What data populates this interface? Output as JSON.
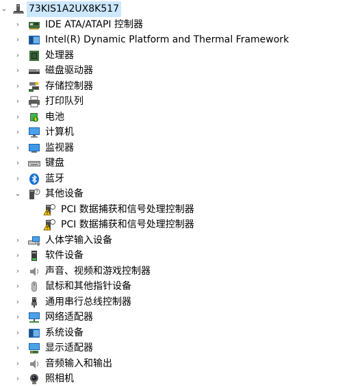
{
  "root": {
    "label": "73KIS1A2UX8K517",
    "expanded": true,
    "selected": true,
    "icon": "computer-icon"
  },
  "categories": [
    {
      "label": "IDE ATA/ATAPI 控制器",
      "icon": "ide-controller-icon",
      "expanded": false
    },
    {
      "label": "Intel(R) Dynamic Platform and Thermal Framework",
      "icon": "platform-device-icon",
      "expanded": false
    },
    {
      "label": "处理器",
      "icon": "processor-icon",
      "expanded": false
    },
    {
      "label": "磁盘驱动器",
      "icon": "disk-drive-icon",
      "expanded": false
    },
    {
      "label": "存储控制器",
      "icon": "storage-controller-icon",
      "expanded": false
    },
    {
      "label": "打印队列",
      "icon": "printer-icon",
      "expanded": false
    },
    {
      "label": "电池",
      "icon": "battery-icon",
      "expanded": false
    },
    {
      "label": "计算机",
      "icon": "computer-monitor-icon",
      "expanded": false
    },
    {
      "label": "监视器",
      "icon": "monitor-icon",
      "expanded": false
    },
    {
      "label": "键盘",
      "icon": "keyboard-icon",
      "expanded": false
    },
    {
      "label": "蓝牙",
      "icon": "bluetooth-icon",
      "expanded": false
    },
    {
      "label": "其他设备",
      "icon": "unknown-device-icon",
      "expanded": true,
      "children": [
        {
          "label": "PCI 数据捕获和信号处理控制器",
          "icon": "warning-device-icon"
        },
        {
          "label": "PCI 数据捕获和信号处理控制器",
          "icon": "warning-device-icon"
        }
      ]
    },
    {
      "label": "人体学输入设备",
      "icon": "hid-icon",
      "expanded": false
    },
    {
      "label": "软件设备",
      "icon": "software-device-icon",
      "expanded": false
    },
    {
      "label": "声音、视频和游戏控制器",
      "icon": "speaker-icon",
      "expanded": false
    },
    {
      "label": "鼠标和其他指针设备",
      "icon": "mouse-icon",
      "expanded": false
    },
    {
      "label": "通用串行总线控制器",
      "icon": "usb-icon",
      "expanded": false
    },
    {
      "label": "网络适配器",
      "icon": "network-adapter-icon",
      "expanded": false
    },
    {
      "label": "系统设备",
      "icon": "system-device-icon",
      "expanded": false
    },
    {
      "label": "显示适配器",
      "icon": "display-adapter-icon",
      "expanded": false
    },
    {
      "label": "音频输入和输出",
      "icon": "audio-io-icon",
      "expanded": false
    },
    {
      "label": "照相机",
      "icon": "camera-icon",
      "expanded": false
    }
  ],
  "colors": {
    "selection": "#cce8ff",
    "chevron": "#6b6b6b",
    "bluetooth": "#1470d6",
    "warning": "#f5c200"
  }
}
